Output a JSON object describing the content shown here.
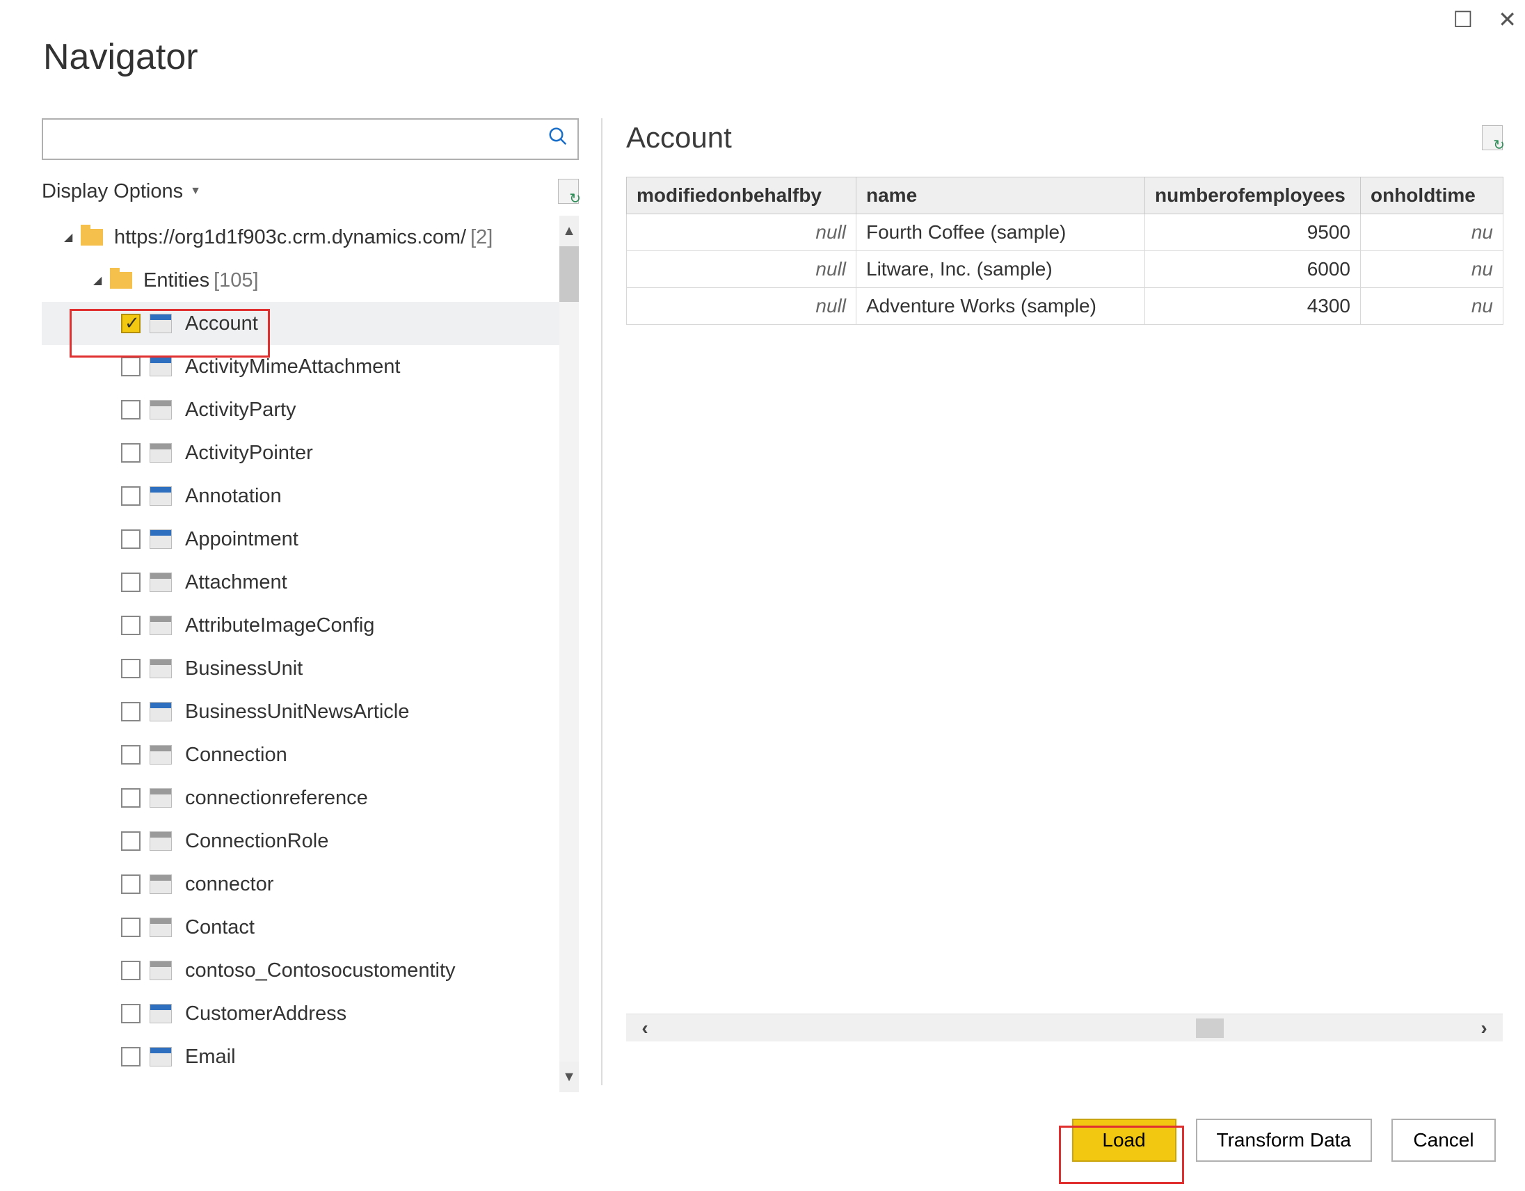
{
  "dialog": {
    "title": "Navigator"
  },
  "window_controls": {
    "maximize": "☐",
    "close": "✕"
  },
  "left": {
    "search_placeholder": "",
    "display_options_label": "Display Options",
    "refresh_tooltip": "Refresh",
    "root": {
      "label": "https://org1d1f903c.crm.dynamics.com/",
      "count": "[2]"
    },
    "entities": {
      "label": "Entities",
      "count": "[105]"
    },
    "items": [
      {
        "label": "Account",
        "checked": true,
        "icon": "blue"
      },
      {
        "label": "ActivityMimeAttachment",
        "checked": false,
        "icon": "blue"
      },
      {
        "label": "ActivityParty",
        "checked": false,
        "icon": "grey"
      },
      {
        "label": "ActivityPointer",
        "checked": false,
        "icon": "grey"
      },
      {
        "label": "Annotation",
        "checked": false,
        "icon": "blue"
      },
      {
        "label": "Appointment",
        "checked": false,
        "icon": "blue"
      },
      {
        "label": "Attachment",
        "checked": false,
        "icon": "grey"
      },
      {
        "label": "AttributeImageConfig",
        "checked": false,
        "icon": "grey"
      },
      {
        "label": "BusinessUnit",
        "checked": false,
        "icon": "grey"
      },
      {
        "label": "BusinessUnitNewsArticle",
        "checked": false,
        "icon": "blue"
      },
      {
        "label": "Connection",
        "checked": false,
        "icon": "grey"
      },
      {
        "label": "connectionreference",
        "checked": false,
        "icon": "grey"
      },
      {
        "label": "ConnectionRole",
        "checked": false,
        "icon": "grey"
      },
      {
        "label": "connector",
        "checked": false,
        "icon": "grey"
      },
      {
        "label": "Contact",
        "checked": false,
        "icon": "grey"
      },
      {
        "label": "contoso_Contosocustomentity",
        "checked": false,
        "icon": "grey"
      },
      {
        "label": "CustomerAddress",
        "checked": false,
        "icon": "blue"
      },
      {
        "label": "Email",
        "checked": false,
        "icon": "blue"
      }
    ],
    "selected_index": 0
  },
  "preview": {
    "title": "Account",
    "columns": [
      "modifiedonbehalfby",
      "name",
      "numberofemployees",
      "onholdtime"
    ],
    "null_text": "null",
    "rows": [
      {
        "modifiedonbehalfby": null,
        "name": "Fourth Coffee (sample)",
        "numberofemployees": 9500,
        "onholdtime": null
      },
      {
        "modifiedonbehalfby": null,
        "name": "Litware, Inc. (sample)",
        "numberofemployees": 6000,
        "onholdtime": null
      },
      {
        "modifiedonbehalfby": null,
        "name": "Adventure Works (sample)",
        "numberofemployees": 4300,
        "onholdtime": null
      }
    ],
    "onhold_overflow": "nu"
  },
  "footer": {
    "load": "Load",
    "transform": "Transform Data",
    "cancel": "Cancel"
  }
}
